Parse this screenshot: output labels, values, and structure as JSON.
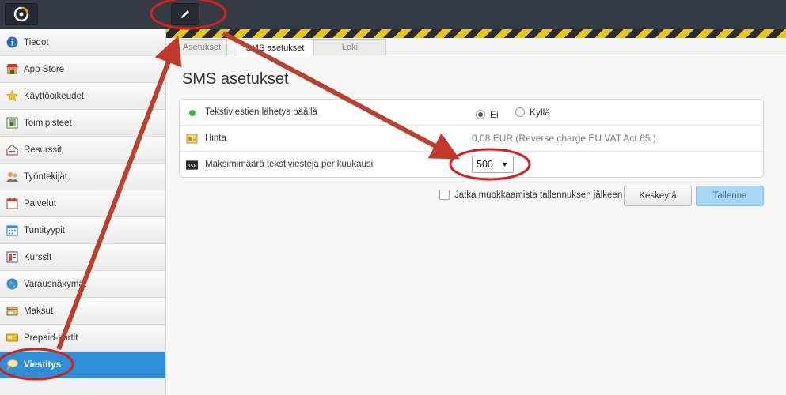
{
  "topbar": {
    "logo_icon": "app-logo-icon",
    "edit_icon": "pencil-icon"
  },
  "sidebar": {
    "items": [
      {
        "label": "Tiedot",
        "icon": "info-icon"
      },
      {
        "label": "App Store",
        "icon": "store-icon"
      },
      {
        "label": "Käyttöoikeudet",
        "icon": "star-icon"
      },
      {
        "label": "Toimipisteet",
        "icon": "location-icon"
      },
      {
        "label": "Resurssit",
        "icon": "resource-icon"
      },
      {
        "label": "Työntekijät",
        "icon": "people-icon"
      },
      {
        "label": "Palvelut",
        "icon": "calendar-icon"
      },
      {
        "label": "Tuntityypit",
        "icon": "calendar-grid-icon"
      },
      {
        "label": "Kurssit",
        "icon": "course-icon"
      },
      {
        "label": "Varausnäkymät",
        "icon": "globe-icon"
      },
      {
        "label": "Maksut",
        "icon": "payment-icon"
      },
      {
        "label": "Prepaid-kortit",
        "icon": "prepaid-card-icon"
      },
      {
        "label": "Viestitys",
        "icon": "chat-icon",
        "active": true
      }
    ]
  },
  "tabs": [
    {
      "label": "Asetukset",
      "active": false
    },
    {
      "label": "SMS asetukset",
      "active": true
    },
    {
      "label": "Loki",
      "active": false
    }
  ],
  "main": {
    "title": "SMS asetukset",
    "rows": {
      "sending": {
        "label": "Tekstiviestien lähetys päällä",
        "option_no": "Ei",
        "option_yes": "Kyllä",
        "selected": "Ei",
        "status_icon": "green-dot-icon"
      },
      "price": {
        "label": "Hinta",
        "value": "0,08 EUR (Reverse charge EU VAT Act 65.)",
        "icon": "price-tag-icon"
      },
      "max": {
        "label": "Maksimimäärä tekstiviestejä per kuukausi",
        "value": "500",
        "icon": "sms-count-icon",
        "icon_text": "35B"
      }
    },
    "continue_editing": "Jatka muokkaamista tallennuksen jälkeen",
    "cancel": "Keskeytä",
    "save": "Tallenna"
  },
  "colors": {
    "topbar": "#353b45",
    "active_sidebar": "#2f8ed8",
    "annotation": "#c0392b",
    "hazard_yellow": "#e8c61a",
    "save_button": "#a9d6f4"
  }
}
